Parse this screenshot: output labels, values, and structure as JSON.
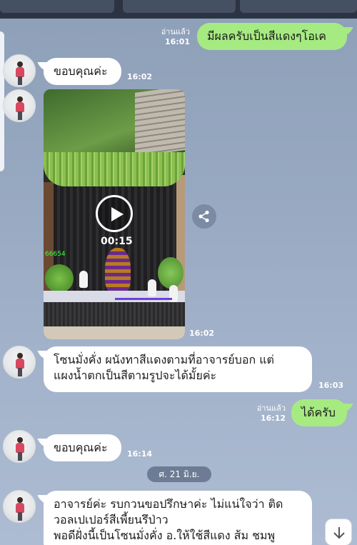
{
  "messages": {
    "m1": {
      "text": "มีผลครับเป็นสีแดงๆโอเค",
      "read": "อ่านแล้ว",
      "time": "16:01"
    },
    "m2": {
      "text": "ขอบคุณค่ะ",
      "time": "16:02"
    },
    "m3": {
      "duration": "00:15",
      "time": "16:02",
      "watermark": "66654"
    },
    "m4": {
      "line1": "โซนมั่งคั่ง ผนังทาสีแดงตามที่อาจารย์บอก แต่",
      "line2": "แผงน้ำตกเป็นสีตามรูปจะได้มั้ยค่ะ",
      "time": "16:03"
    },
    "m5": {
      "text": "ได้ครับ",
      "read": "อ่านแล้ว",
      "time": "16:12"
    },
    "m6": {
      "text": "ขอบคุณค่ะ",
      "time": "16:14"
    },
    "date_separator": "ศ. 21 มิ.ย.",
    "m7": {
      "line1": "อาจารย์ค่ะ รบกวนขอปรึกษาค่ะ ไม่แน่ใจว่า ติด",
      "line2": "วอลเปเปอร์สีเพี้ยนรึป่าว",
      "line3": "พอดีฝั่งนี้เป็นโซนมั่งคั่ง อ.ให้ใช้สีแดง ส้ม ชมพู"
    }
  },
  "colors": {
    "outgoing_bubble": "#a6ea82",
    "incoming_bubble": "#ffffff",
    "background": "#97a8c1"
  },
  "icons": {
    "play": "play-icon",
    "share": "share-icon",
    "scroll": "arrow-down-icon"
  }
}
